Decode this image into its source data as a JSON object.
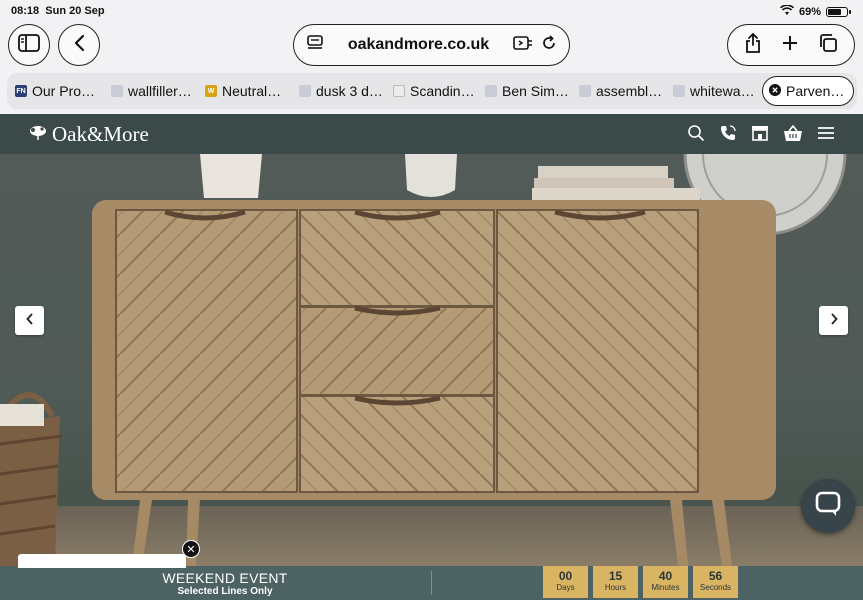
{
  "status": {
    "time": "08:18",
    "date": "Sun 20 Sep",
    "battery": "69%"
  },
  "toolbar": {
    "url": "oakandmore.co.uk"
  },
  "tabs": [
    {
      "label": "Our Pro…",
      "favicon": "FN",
      "fav_color": "#2d3f73"
    },
    {
      "label": "wallfiller…",
      "favicon": "",
      "fav_color": "#c9ccd6"
    },
    {
      "label": "Neutral…",
      "favicon": "W",
      "fav_color": "#d9a318"
    },
    {
      "label": "dusk 3 d…",
      "favicon": "",
      "fav_color": "#c9ccd6"
    },
    {
      "label": "Scandin…",
      "favicon": "",
      "fav_color": "#e8e8ea"
    },
    {
      "label": "Ben Sim…",
      "favicon": "",
      "fav_color": "#c9ccd6"
    },
    {
      "label": "assembl…",
      "favicon": "",
      "fav_color": "#c9ccd6"
    },
    {
      "label": "whitewa…",
      "favicon": "",
      "fav_color": "#c9ccd6"
    },
    {
      "label": "Parven…",
      "favicon": "",
      "fav_color": "#111111"
    }
  ],
  "site": {
    "logo": "Oak&More",
    "header_color": "#3b4a48"
  },
  "event": {
    "title": "WEEKEND EVENT",
    "subtitle": "Selected Lines Only",
    "countdown": [
      {
        "value": "00",
        "label": "Days"
      },
      {
        "value": "15",
        "label": "Hours"
      },
      {
        "value": "40",
        "label": "Minutes"
      },
      {
        "value": "56",
        "label": "Seconds"
      }
    ]
  }
}
